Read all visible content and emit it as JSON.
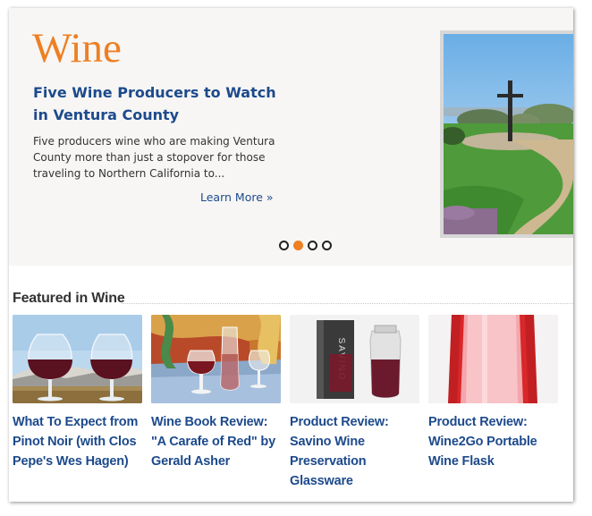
{
  "hero": {
    "section_title": "Wine",
    "headline": "Five Wine Producers to Watch in Ventura County",
    "excerpt": "Five producers wine who are making Ventura County more than just a stopover for those traveling to Northern California to...",
    "learn_more": "Learn More »",
    "image_icon": "hillside-cross-photo",
    "slides": 4,
    "active_slide": 2
  },
  "featured": {
    "heading": "Featured in Wine",
    "cards": [
      {
        "title": "What To Expect from Pinot Noir (with Clos Pepe's Wes Hagen)",
        "image_icon": "wine-glasses-photo"
      },
      {
        "title": "Wine Book Review: \"A Carafe of Red\" by Gerald Asher",
        "image_icon": "carafe-painting-photo"
      },
      {
        "title": "Product Review: Savino Wine Preservation Glassware",
        "image_icon": "savino-carafe-photo"
      },
      {
        "title": "Product Review: Wine2Go Portable Wine Flask",
        "image_icon": "wine-flask-photo"
      }
    ]
  },
  "colors": {
    "accent_orange": "#ee7f22",
    "link_blue": "#1d4a8c",
    "hero_background": "#f7f6f4"
  }
}
